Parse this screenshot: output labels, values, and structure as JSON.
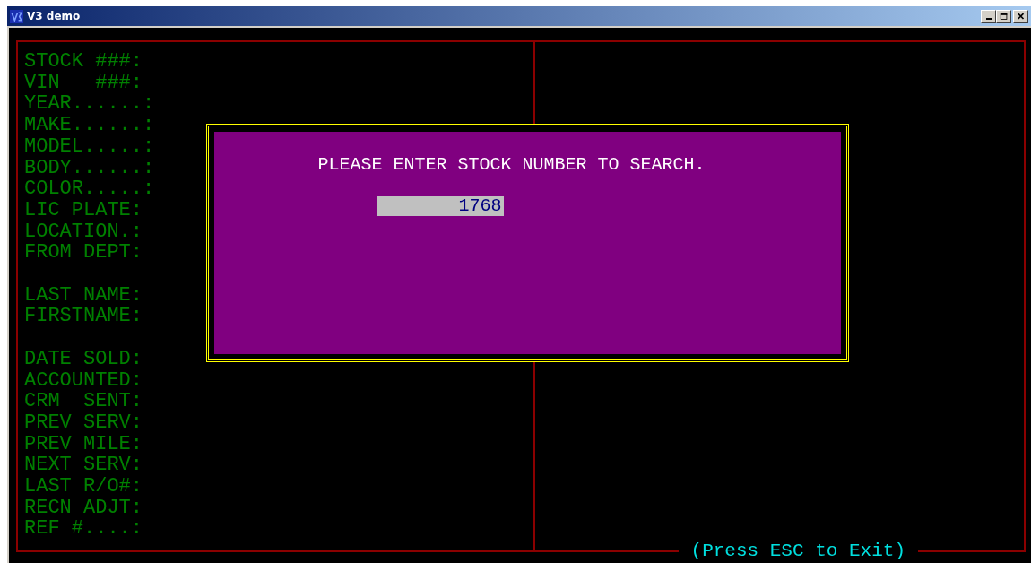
{
  "window": {
    "title": "V3 demo"
  },
  "field_groups": [
    [
      "STOCK ###:",
      "VIN   ###:",
      "YEAR......:",
      "MAKE......:",
      "MODEL.....:",
      "BODY......:",
      "COLOR.....:",
      "LIC PLATE:",
      "LOCATION.:",
      "FROM DEPT:"
    ],
    [
      "LAST NAME:",
      "FIRSTNAME:"
    ],
    [
      "DATE SOLD:",
      "ACCOUNTED:",
      "CRM  SENT:",
      "PREV SERV:",
      "PREV MILE:",
      "NEXT SERV:",
      "LAST R/O#:",
      "RECN ADJT:",
      "REF #....:"
    ]
  ],
  "dialog": {
    "prompt": "PLEASE ENTER STOCK NUMBER TO SEARCH.",
    "value": "1768"
  },
  "footer": "(Press ESC to Exit)"
}
